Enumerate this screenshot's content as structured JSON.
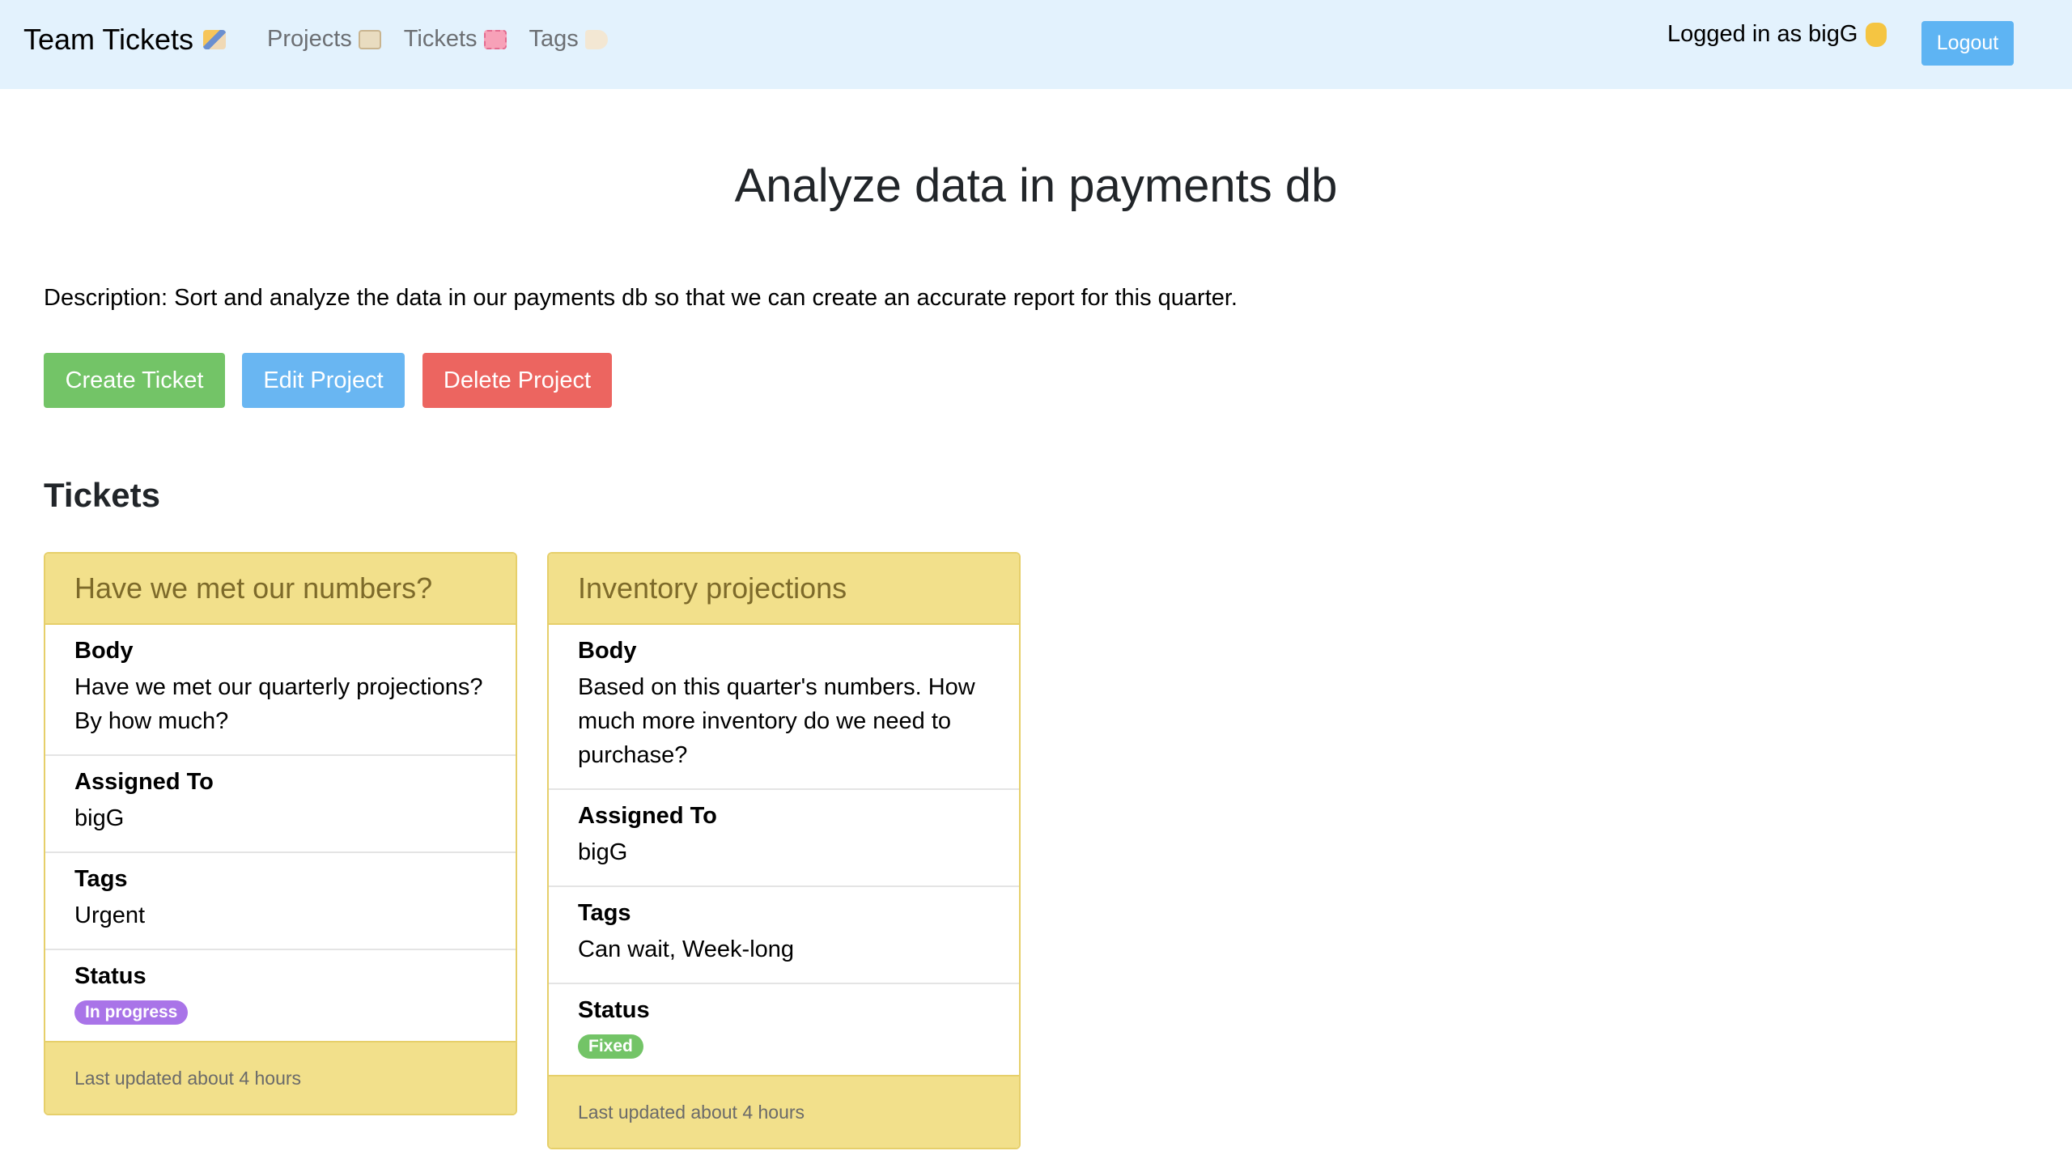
{
  "navbar": {
    "brand": "Team Tickets",
    "links": [
      {
        "label": "Projects",
        "icon": "folder-icon"
      },
      {
        "label": "Tickets",
        "icon": "ticket-icon"
      },
      {
        "label": "Tags",
        "icon": "tag-icon"
      }
    ],
    "logged_in": "Logged in as bigG",
    "logout_label": "Logout"
  },
  "project": {
    "title": "Analyze data in payments db",
    "description": "Description: Sort and analyze the data in our payments db so that we can create an accurate report for this quarter."
  },
  "actions": {
    "create": "Create Ticket",
    "edit": "Edit Project",
    "delete": "Delete Project"
  },
  "tickets_section": {
    "title": "Tickets",
    "labels": {
      "body": "Body",
      "assigned": "Assigned To",
      "tags": "Tags",
      "status": "Status"
    }
  },
  "tickets": [
    {
      "title": "Have we met our numbers?",
      "body": "Have we met our quarterly projections? By how much?",
      "assigned_to": "bigG",
      "tags": "Urgent",
      "status": "In progress",
      "footer": "Last updated about 4 hours"
    },
    {
      "title": "Inventory projections",
      "body": "Based on this quarter's numbers. How much more inventory do we need to purchase?",
      "assigned_to": "bigG",
      "tags": "Can wait, Week-long",
      "status": "Fixed",
      "footer": "Last updated about 4 hours"
    }
  ],
  "colors": {
    "navbar_bg": "#e3f2fd",
    "create": "#73c467",
    "edit": "#69b6f2",
    "delete": "#ec6560",
    "card_header": "#f2e08b",
    "badge_in_progress": "#a974e8",
    "badge_fixed": "#73c467"
  }
}
